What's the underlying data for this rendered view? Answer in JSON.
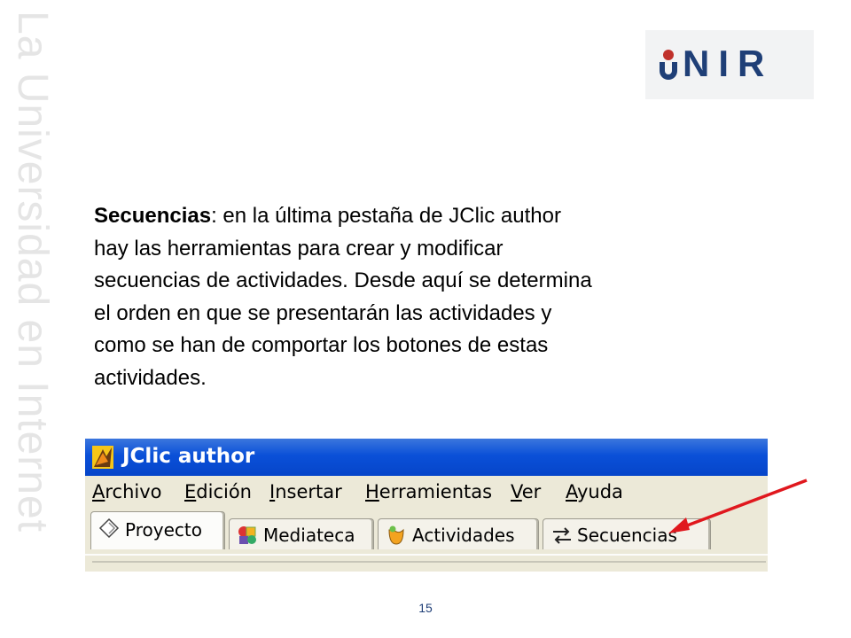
{
  "slide": {
    "watermark": "La Universidad en Internet",
    "logo": {
      "text": "UNIR",
      "mark_color": "#c0312b",
      "text_color": "#1f3f77"
    },
    "paragraph": {
      "bold": "Secuencias",
      "lines": [
        ": en la última pestaña de JClic author",
        "hay las herramientas para crear y modificar",
        "secuencias de actividades. Desde aquí se determina",
        "el orden en que se presentarán las actividades y",
        "como se han de comportar los botones de estas",
        "actividades."
      ]
    },
    "page_number": "15"
  },
  "screenshot": {
    "window_title": "JClic author",
    "title_bar_color": "#0a50d8",
    "menu": [
      "Archivo",
      "Edición",
      "Insertar",
      "Herramientas",
      "Ver",
      "Ayuda"
    ],
    "tabs": [
      {
        "label": "Proyecto",
        "icon": "project-icon",
        "active": true
      },
      {
        "label": "Mediateca",
        "icon": "media-library-icon",
        "active": false
      },
      {
        "label": "Actividades",
        "icon": "activities-icon",
        "active": false
      },
      {
        "label": "Secuencias",
        "icon": "sequences-icon",
        "active": false
      }
    ]
  },
  "annotation": {
    "icon": "red-arrow-icon",
    "color": "#e0181e"
  }
}
